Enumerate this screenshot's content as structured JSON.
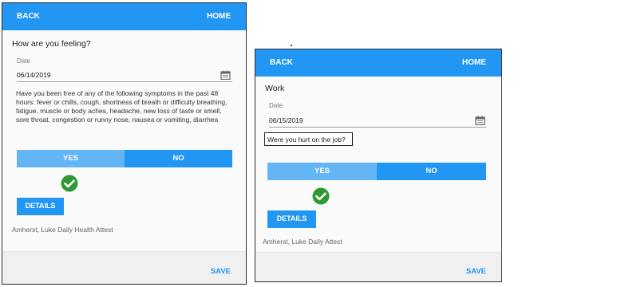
{
  "left": {
    "nav": {
      "back": "BACK",
      "home": "HOME"
    },
    "title": "How are you feeling?",
    "date_label": "Date",
    "date_value": "06/14/2019",
    "question": "Have you been free of any of the following symptoms in the past 48 hours: fever or chills, cough, shortness of breath or difficulty breathing, fatigue, muscle or body aches, headache, new loss of taste or smell, sore throat, congestion or runny nose, nausea or vomiting, diarrhea",
    "yes_label": "YES",
    "no_label": "NO",
    "details_label": "DETAILS",
    "footer": "Amherst, Luke Daily Health Attest",
    "save_label": "SAVE"
  },
  "right": {
    "nav": {
      "back": "BACK",
      "home": "HOME"
    },
    "title": "Work",
    "date_label": "Date",
    "date_value": "06/15/2019",
    "question": "Were you hurt on the job?",
    "yes_label": "YES",
    "no_label": "NO",
    "details_label": "DETAILS",
    "footer": "Amherst, Luke Daily Attest",
    "save_label": "SAVE"
  },
  "colors": {
    "primary": "#2196f3",
    "selected_light": "#64b5f6",
    "check_green": "#2e9a34"
  },
  "icons": {
    "calendar": "calendar-icon",
    "check": "check-circle-icon"
  }
}
